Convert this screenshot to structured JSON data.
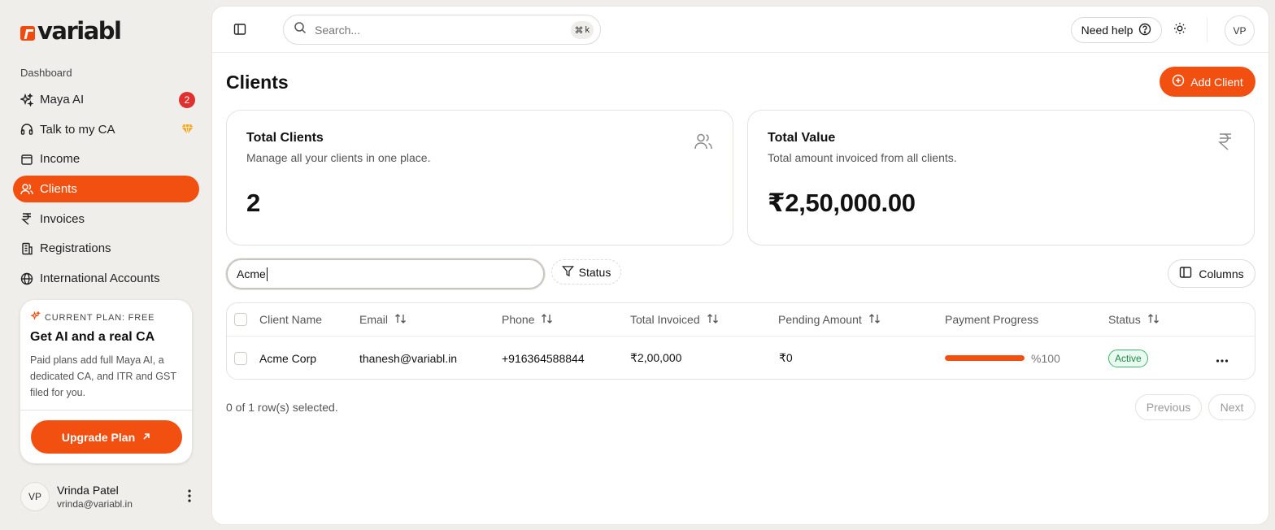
{
  "brand": {
    "name": "variabl",
    "accent": "#f25011"
  },
  "sidebar": {
    "section_label": "Dashboard",
    "items": [
      {
        "label": "Maya AI",
        "icon": "sparkles-icon",
        "badge": "2"
      },
      {
        "label": "Talk to my CA",
        "icon": "headphones-icon",
        "premium": true
      },
      {
        "label": "Income",
        "icon": "wallet-icon"
      },
      {
        "label": "Clients",
        "icon": "users-icon",
        "active": true
      },
      {
        "label": "Invoices",
        "icon": "rupee-icon"
      },
      {
        "label": "Registrations",
        "icon": "building-icon"
      },
      {
        "label": "International Accounts",
        "icon": "globe-icon"
      }
    ],
    "plan": {
      "tag": "CURRENT PLAN: FREE",
      "title": "Get AI and a real CA",
      "description": "Paid plans add full Maya AI, a dedicated CA, and ITR and GST filed for you.",
      "upgrade_label": "Upgrade Plan"
    },
    "user": {
      "initials": "VP",
      "name": "Vrinda Patel",
      "email": "vrinda@variabl.in"
    }
  },
  "topbar": {
    "search_placeholder": "Search...",
    "shortcut_symbol": "⌘",
    "shortcut_key": "k",
    "help_label": "Need help",
    "avatar_initials": "VP"
  },
  "page": {
    "title": "Clients",
    "add_label": "Add Client"
  },
  "stats": [
    {
      "title": "Total Clients",
      "subtitle": "Manage all your clients in one place.",
      "value": "2",
      "icon": "users-icon"
    },
    {
      "title": "Total Value",
      "subtitle": "Total amount invoiced from all clients.",
      "value": "₹2,50,000.00",
      "icon": "rupee-icon"
    }
  ],
  "filters": {
    "query": "Acme",
    "status_label": "Status",
    "columns_label": "Columns"
  },
  "table": {
    "headers": [
      "Client Name",
      "Email",
      "Phone",
      "Total Invoiced",
      "Pending Amount",
      "Payment Progress",
      "Status"
    ],
    "rows": [
      {
        "client_name": "Acme Corp",
        "email": "thanesh@variabl.in",
        "phone": "+916364588844",
        "total_invoiced": "₹2,00,000",
        "pending_amount": "₹0",
        "progress": 100,
        "progress_label": "%100",
        "status": "Active"
      }
    ],
    "selection_text": "0 of 1 row(s) selected.",
    "previous_label": "Previous",
    "next_label": "Next"
  }
}
